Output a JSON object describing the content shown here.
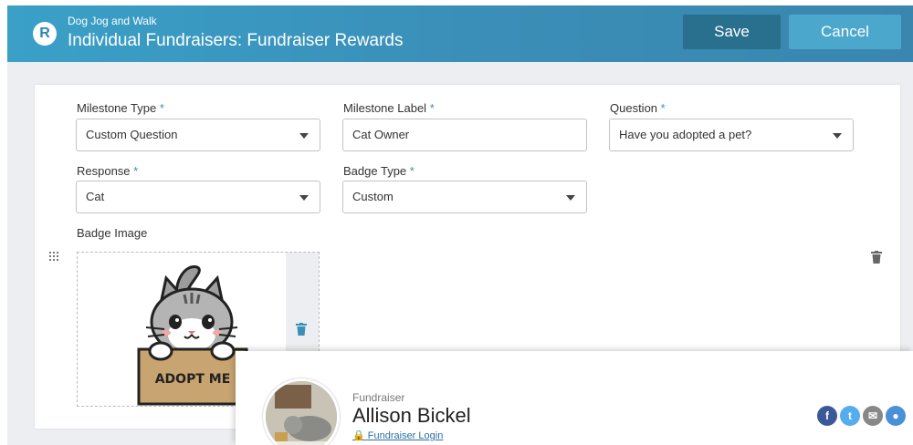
{
  "header": {
    "logo_letter": "R",
    "org_name": "Dog Jog and Walk",
    "title": "Individual Fundraisers: Fundraiser Rewards",
    "save_label": "Save",
    "cancel_label": "Cancel"
  },
  "form": {
    "milestone_type": {
      "label": "Milestone Type",
      "required": "*",
      "value": "Custom Question"
    },
    "milestone_label": {
      "label": "Milestone Label",
      "required": "*",
      "value": "Cat Owner"
    },
    "question": {
      "label": "Question",
      "required": "*",
      "value": "Have you adopted a pet?"
    },
    "response": {
      "label": "Response",
      "required": "*",
      "value": "Cat"
    },
    "badge_type": {
      "label": "Badge Type",
      "required": "*",
      "value": "Custom"
    },
    "badge_image": {
      "label": "Badge Image",
      "box_text": "ADOPT ME"
    }
  },
  "fundraiser": {
    "label": "Fundraiser",
    "name": "Allison Bickel",
    "login_text": "Fundraiser Login",
    "social": [
      "facebook-icon",
      "twitter-icon",
      "email-icon",
      "chat-icon"
    ]
  },
  "colors": {
    "header": "#3a8fb8",
    "save": "#296f8e",
    "cancel": "#4ba7cc",
    "facebook": "#3b5998",
    "twitter": "#55acee",
    "email": "#888888",
    "chat": "#4a90d9"
  }
}
